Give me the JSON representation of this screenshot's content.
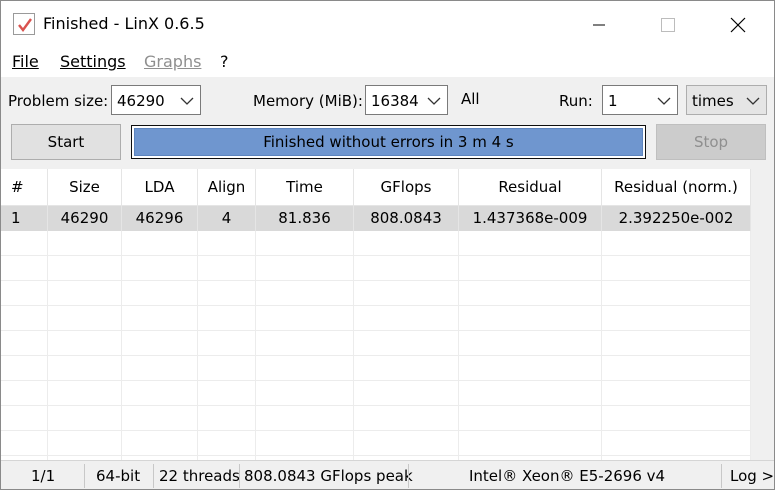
{
  "window": {
    "title": "Finished - LinX 0.6.5"
  },
  "menu": {
    "file": "File",
    "settings": "Settings",
    "graphs": "Graphs",
    "help": "?"
  },
  "controls": {
    "problem_size_label": "Problem size:",
    "problem_size_value": "46290",
    "memory_label": "Memory (MiB):",
    "memory_value": "16384",
    "all_label": "All",
    "run_label": "Run:",
    "run_value": "1",
    "times_value": "times",
    "start_label": "Start",
    "stop_label": "Stop",
    "progress_text": "Finished without errors in 3 m 4 s",
    "progress_fraction": 1.0
  },
  "table": {
    "headers": [
      "#",
      "Size",
      "LDA",
      "Align",
      "Time",
      "GFlops",
      "Residual",
      "Residual (norm.)"
    ],
    "rows": [
      [
        "1",
        "46290",
        "46296",
        "4",
        "81.836",
        "808.0843",
        "1.437368e-009",
        "2.392250e-002"
      ]
    ]
  },
  "status": {
    "page": "1/1",
    "arch": "64-bit",
    "threads": "22 threads",
    "peak": "808.0843 GFlops peak",
    "cpu": "Intel® Xeon® E5-2696 v4",
    "log": "Log >"
  },
  "colors": {
    "progress_fill": "#6f96cf",
    "selected_row": "#d9d9d9"
  }
}
